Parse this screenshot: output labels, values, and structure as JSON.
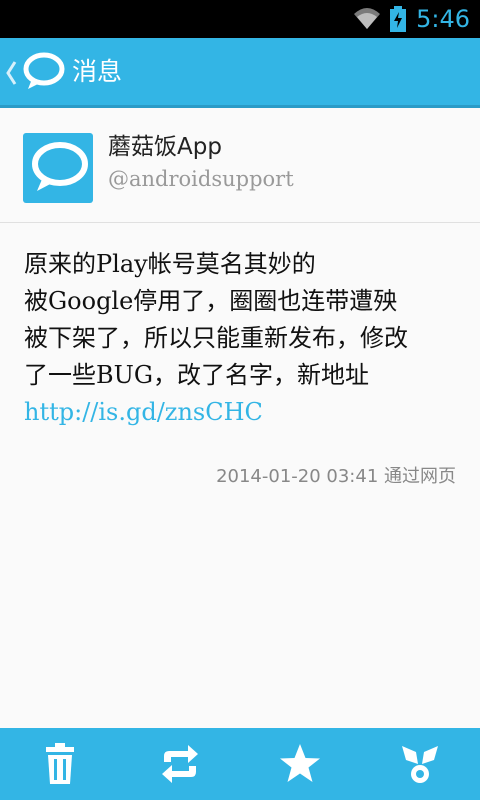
{
  "status_bar": {
    "time": "5:46",
    "icons": [
      "wifi-icon",
      "battery-charging-icon"
    ],
    "accent": "#33b5e5"
  },
  "action_bar": {
    "title": "消息",
    "back_icon": "chevron-left-icon",
    "app_icon": "speech-bubble-icon",
    "color": "#33b5e5"
  },
  "user": {
    "name": "蘑菇饭App",
    "handle": "@androidsupport",
    "avatar_icon": "speech-bubble-icon"
  },
  "message": {
    "lines": [
      "原来的Play帐号莫名其妙的",
      "被Google停用了，圈圈也连带遭殃",
      "被下架了，所以只能重新发布，修改",
      "了一些BUG，改了名字，新地址"
    ],
    "link": "http://is.gd/znsCHC",
    "timestamp": "2014-01-20 03:41",
    "source": "通过网页"
  },
  "bottom_bar": {
    "actions": [
      "trash-icon",
      "retweet-icon",
      "star-icon",
      "share-icon"
    ]
  }
}
